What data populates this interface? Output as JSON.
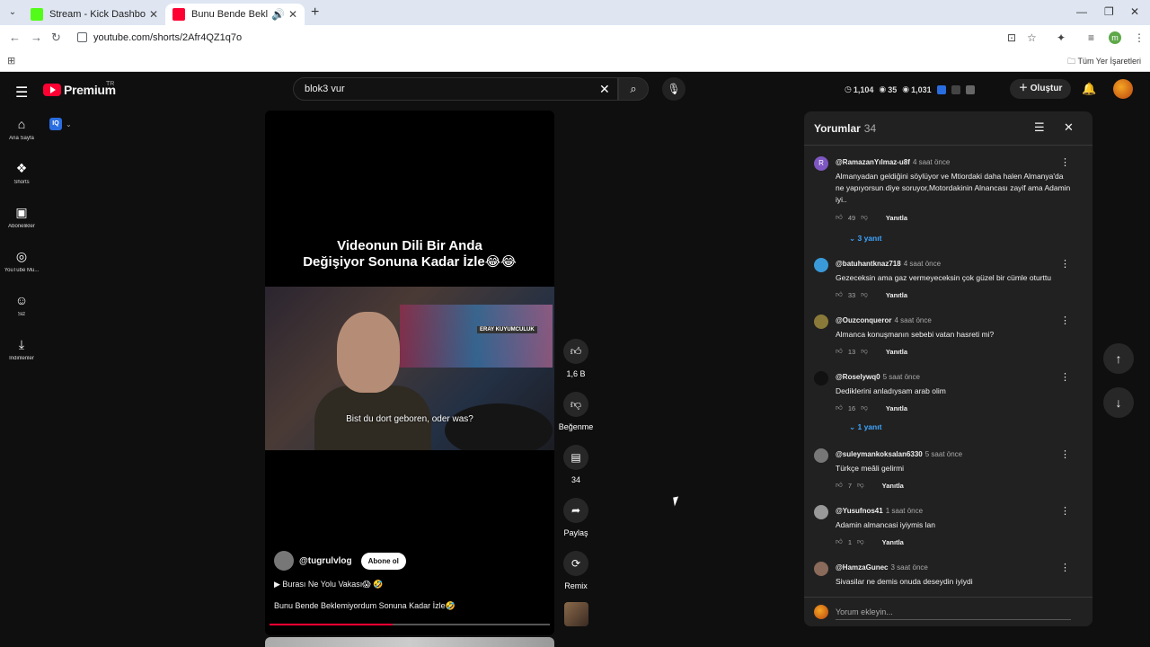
{
  "browser": {
    "tabs": [
      {
        "title": "Stream - Kick Dashboard",
        "favicon_color": "#53fc18"
      },
      {
        "title": "Bunu Bende Beklemiyordum",
        "favicon_color": "#ff0033"
      }
    ],
    "url": "youtube.com/shorts/2Afr4QZ1q7o",
    "bookmarks_all": "Tüm Yer İşaretleri",
    "profile_initial": "m"
  },
  "header": {
    "logo_text": "Premium",
    "region": "TR",
    "search_value": "blok3 vur",
    "stats": [
      "1,104",
      "35",
      "1,031"
    ],
    "create_label": "Oluştur"
  },
  "sidebar": {
    "items": [
      {
        "label": "Ana Sayfa",
        "icon": "home-icon",
        "glyph": "⌂"
      },
      {
        "label": "Shorts",
        "icon": "shorts-icon",
        "glyph": "❖"
      },
      {
        "label": "Abonelikler",
        "icon": "subscriptions-icon",
        "glyph": "▣"
      },
      {
        "label": "YouTube Mu...",
        "icon": "music-icon",
        "glyph": "◎"
      },
      {
        "label": "Siz",
        "icon": "you-icon",
        "glyph": "☺"
      },
      {
        "label": "İndirilenler",
        "icon": "download-icon",
        "glyph": "⤓"
      }
    ],
    "iq_label": "IQ"
  },
  "video": {
    "title_line1": "Videonun Dili Bir Anda",
    "title_line2": "Değişiyor Sonuna Kadar İzle😂😂",
    "subtitle": "Bist du dort geboren, oder was?",
    "sign": "ERAY KUYUMCULUK",
    "channel": "@tugrulvlog",
    "subscribe_label": "Abone ol",
    "music": "▶  Burası Ne Yolu Vakası😱 🤣",
    "description": "Bunu Bende Beklemiyordum Sonuna Kadar İzle🤣",
    "progress": 0.44
  },
  "actions": {
    "like_count": "1,6 B",
    "dislike_label": "Beğenme",
    "comments_count": "34",
    "share_label": "Paylaş",
    "remix_label": "Remix"
  },
  "comments": {
    "title": "Yorumlar",
    "count": "34",
    "add_placeholder": "Yorum ekleyin...",
    "reply_label": "Yanıtla",
    "items": [
      {
        "author": "@RamazanYılmaz-u8f",
        "time": "4 saat önce",
        "text": "Almanyadan geldiğini söylüyor ve Mtiordaki daha halen Almanya'da ne yapıyorsun diye soruyor,Motordakinin Alnancası zayif ama Adamin iyi..",
        "likes": "49",
        "replies": "3 yanıt",
        "avatar_color": "#7e57c2",
        "avatar_letter": "R"
      },
      {
        "author": "@batuhantknaz718",
        "time": "4 saat önce",
        "text": "Gezeceksin ama gaz vermeyeceksin çok güzel bir cümle oturttu",
        "likes": "33",
        "replies": "",
        "avatar_color": "#3a9ad9",
        "avatar_letter": ""
      },
      {
        "author": "@Ouzconqueror",
        "time": "4 saat önce",
        "text": "Almanca konuşmanın sebebi vatan hasreti mi?",
        "likes": "13",
        "replies": "",
        "avatar_color": "#8a7a3a",
        "avatar_letter": ""
      },
      {
        "author": "@Roselywq0",
        "time": "5 saat önce",
        "text": "Dediklerini anladıysam arab olim",
        "likes": "16",
        "replies": "1 yanıt",
        "avatar_color": "#111111",
        "avatar_letter": ""
      },
      {
        "author": "@suleymankoksalan6330",
        "time": "5 saat önce",
        "text": "Türkçe meâli gelirmi",
        "likes": "7",
        "replies": "",
        "avatar_color": "#777777",
        "avatar_letter": ""
      },
      {
        "author": "@Yusufnos41",
        "time": "1 saat önce",
        "text": "Adamin almancasi iyiymis lan",
        "likes": "1",
        "replies": "",
        "avatar_color": "#999999",
        "avatar_letter": ""
      },
      {
        "author": "@HamzaGunec",
        "time": "3 saat önce",
        "text": "Sivasilar ne demis onuda deseydin iyiydi",
        "likes": "",
        "replies": "",
        "avatar_color": "#8a6a5a",
        "avatar_letter": ""
      }
    ]
  }
}
